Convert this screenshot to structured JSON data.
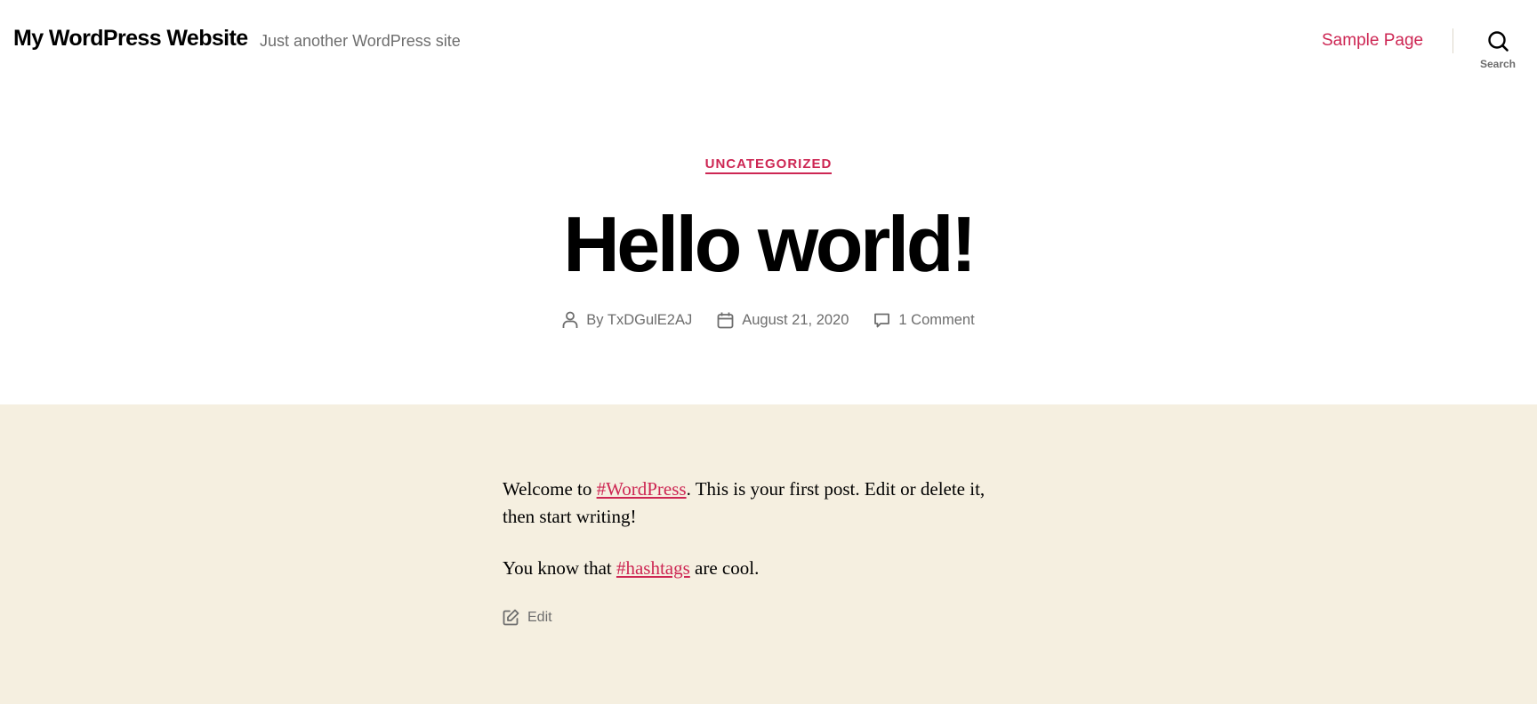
{
  "header": {
    "site_title": "My WordPress Website",
    "tagline": "Just another WordPress site",
    "nav": [
      {
        "label": "Sample Page"
      }
    ],
    "search_label": "Search"
  },
  "post": {
    "category": "UNCATEGORIZED",
    "title": "Hello world!",
    "meta": {
      "author_prefix": "By",
      "author": "TxDGulE2AJ",
      "date": "August 21, 2020",
      "comments": "1 Comment"
    },
    "content": {
      "p1_before": "Welcome to ",
      "p1_link": "#WordPress",
      "p1_after": ". This is your first post. Edit or delete it, then start writing!",
      "p2_before": "You know that ",
      "p2_link": "#hashtags",
      "p2_after": " are cool."
    },
    "edit_label": "Edit"
  },
  "colors": {
    "accent": "#cd2653",
    "content_background": "#f5efe0",
    "secondary_text": "#6d6d6d"
  }
}
